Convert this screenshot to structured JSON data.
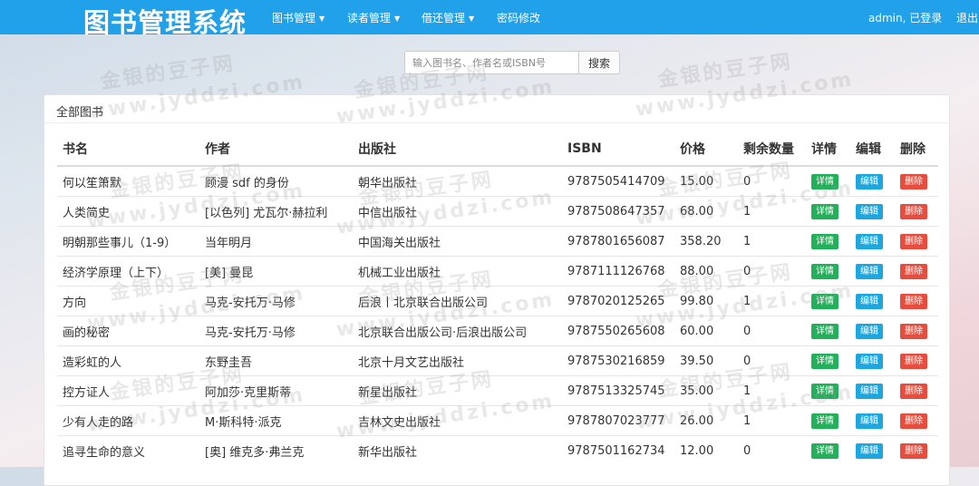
{
  "header": {
    "brand": "图书管理系统",
    "menus": [
      {
        "label": "图书管理",
        "caret": "▼"
      },
      {
        "label": "读者管理",
        "caret": "▼"
      },
      {
        "label": "借还管理",
        "caret": "▼"
      },
      {
        "label": "密码修改",
        "caret": ""
      }
    ],
    "user_status": "admin, 已登录",
    "logout": "退出"
  },
  "search": {
    "placeholder": "输入图书名、作者名或ISBN号",
    "button": "搜索"
  },
  "panel": {
    "title": "全部图书"
  },
  "table": {
    "headers": [
      "书名",
      "作者",
      "出版社",
      "ISBN",
      "价格",
      "剩余数量",
      "详情",
      "编辑",
      "删除"
    ],
    "rows": [
      [
        "何以笙箫默",
        "顾漫 sdf 的身份",
        "朝华出版社",
        "9787505414709",
        "15.00",
        "0"
      ],
      [
        "人类简史",
        "[以色列] 尤瓦尔·赫拉利",
        "中信出版社",
        "9787508647357",
        "68.00",
        "1"
      ],
      [
        "明朝那些事儿（1-9）",
        "当年明月",
        "中国海关出版社",
        "9787801656087",
        "358.20",
        "1"
      ],
      [
        "经济学原理（上下）",
        "[美] 曼昆",
        "机械工业出版社",
        "9787111126768",
        "88.00",
        "0"
      ],
      [
        "方向",
        "马克-安托万·马修",
        "后浪丨北京联合出版公司",
        "9787020125265",
        "99.80",
        "1"
      ],
      [
        "画的秘密",
        "马克-安托万·马修",
        "北京联合出版公司·后浪出版公司",
        "9787550265608",
        "60.00",
        "0"
      ],
      [
        "造彩虹的人",
        "东野圭吾",
        "北京十月文艺出版社",
        "9787530216859",
        "39.50",
        "0"
      ],
      [
        "控方证人",
        "阿加莎·克里斯蒂",
        "新星出版社",
        "9787513325745",
        "35.00",
        "1"
      ],
      [
        "少有人走的路",
        "M·斯科特·派克",
        "吉林文史出版社",
        "9787807023777",
        "26.00",
        "1"
      ],
      [
        "追寻生命的意义",
        "[奥] 维克多·弗兰克",
        "新华出版社",
        "9787501162734",
        "12.00",
        "0"
      ]
    ],
    "actions": {
      "detail": "详情",
      "edit": "编辑",
      "delete": "删除"
    }
  },
  "watermark": {
    "cn": "金银的豆子网",
    "en": "www.jyddzi.com"
  },
  "colors": {
    "navbar": "#21a1e9",
    "detail": "#23b05b",
    "edit": "#1ea7df",
    "delete": "#e74c3c"
  }
}
